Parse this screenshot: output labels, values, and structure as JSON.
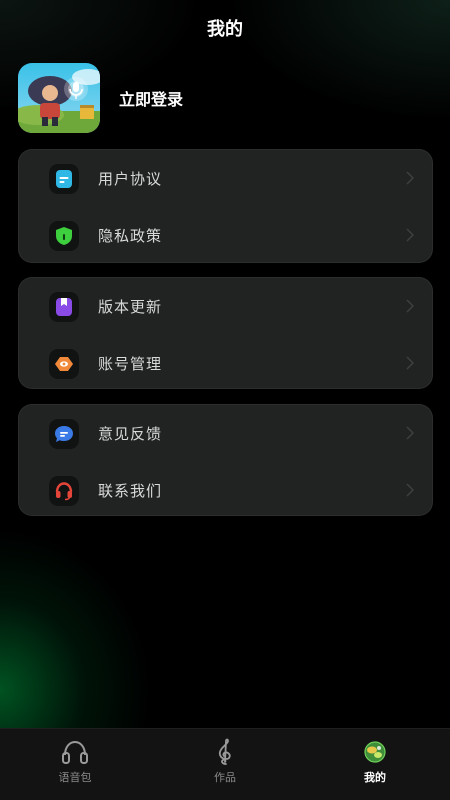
{
  "header": {
    "title": "我的"
  },
  "profile": {
    "login_label": "立即登录",
    "avatar_icon": "game-character-avatar"
  },
  "menu_groups": [
    {
      "items": [
        {
          "label": "用户协议",
          "icon": "document-icon",
          "color": "#2fb8e6"
        },
        {
          "label": "隐私政策",
          "icon": "shield-icon",
          "color": "#3ecf3e"
        }
      ]
    },
    {
      "items": [
        {
          "label": "版本更新",
          "icon": "bookmark-icon",
          "color": "#8a4ae6"
        },
        {
          "label": "账号管理",
          "icon": "account-icon",
          "color": "#f08a3a"
        }
      ]
    },
    {
      "items": [
        {
          "label": "意见反馈",
          "icon": "chat-bubble-icon",
          "color": "#3a7ae6"
        },
        {
          "label": "联系我们",
          "icon": "headset-icon",
          "color": "#e6453a"
        }
      ]
    }
  ],
  "tabbar": {
    "active": "我的",
    "tabs": [
      {
        "label": "语音包",
        "icon": "headphones-icon"
      },
      {
        "label": "作品",
        "icon": "treble-clef-icon"
      },
      {
        "label": "我的",
        "icon": "profile-avatar-icon"
      }
    ]
  }
}
